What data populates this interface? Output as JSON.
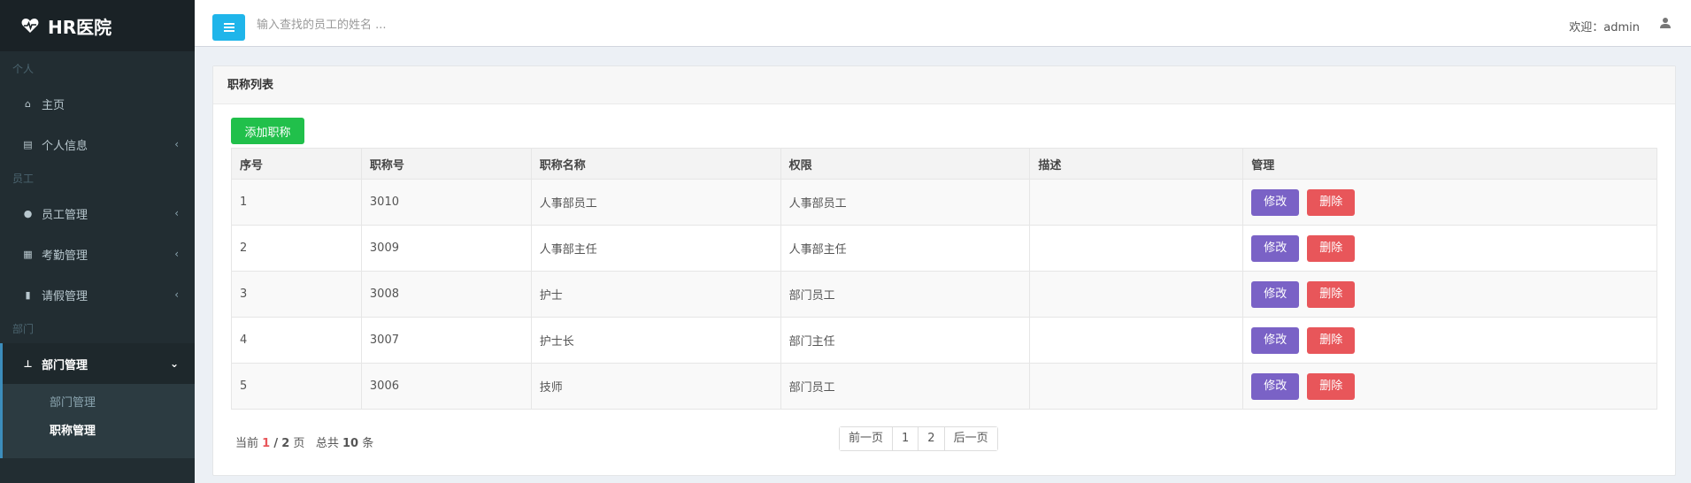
{
  "brand": {
    "name": "HR医院"
  },
  "sidebar": {
    "sections": {
      "personal": "个人",
      "staff": "员工",
      "dept": "部门"
    },
    "items": {
      "home": "主页",
      "profile": "个人信息",
      "employee": "员工管理",
      "attendance": "考勤管理",
      "leave": "请假管理",
      "department": "部门管理"
    },
    "submenu": {
      "dept_manage": "部门管理",
      "title_manage": "职称管理"
    }
  },
  "topbar": {
    "search_placeholder": "输入查找的员工的姓名 ...",
    "welcome": "欢迎：admin"
  },
  "box": {
    "title": "职称列表",
    "add_button": "添加职称"
  },
  "table": {
    "headers": [
      "序号",
      "职称号",
      "职称名称",
      "权限",
      "描述",
      "管理"
    ],
    "rows": [
      {
        "index": "1",
        "code": "3010",
        "name": "人事部员工",
        "permission": "人事部员工",
        "desc": ""
      },
      {
        "index": "2",
        "code": "3009",
        "name": "人事部主任",
        "permission": "人事部主任",
        "desc": ""
      },
      {
        "index": "3",
        "code": "3008",
        "name": "护士",
        "permission": "部门员工",
        "desc": ""
      },
      {
        "index": "4",
        "code": "3007",
        "name": "护士长",
        "permission": "部门主任",
        "desc": ""
      },
      {
        "index": "5",
        "code": "3006",
        "name": "技师",
        "permission": "部门员工",
        "desc": ""
      }
    ],
    "edit_label": "修改",
    "delete_label": "删除"
  },
  "pagination": {
    "prefix": "当前",
    "current": "1",
    "sep": "/",
    "total_pages": "2",
    "page_word": "页",
    "total_prefix": "总共",
    "total_count": "10",
    "total_unit": "条",
    "prev": "前一页",
    "pages": [
      "1",
      "2"
    ],
    "next": "后一页"
  }
}
